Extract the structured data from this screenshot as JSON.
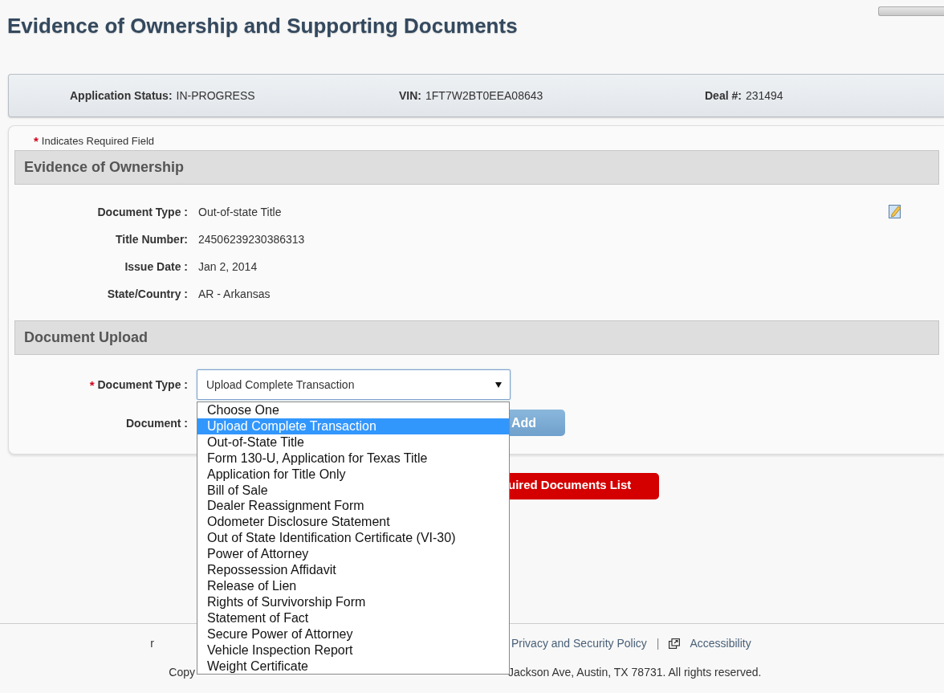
{
  "page": {
    "title": "Evidence of Ownership and Supporting Documents"
  },
  "status": [
    {
      "label": "Application Status:",
      "value": "IN-PROGRESS"
    },
    {
      "label": "VIN:",
      "value": "1FT7W2BT0EEA08643"
    },
    {
      "label": "Deal #:",
      "value": "231494"
    }
  ],
  "required_note": {
    "mark": "*",
    "text": "Indicates Required Field"
  },
  "ownership": {
    "heading": "Evidence of Ownership",
    "fields": [
      {
        "label": "Document Type :",
        "value": "Out-of-state Title"
      },
      {
        "label": "Title Number:",
        "value": "24506239230386313"
      },
      {
        "label": "Issue Date :",
        "value": "Jan 2, 2014"
      },
      {
        "label": "State/Country :",
        "value": "AR - Arkansas"
      }
    ]
  },
  "upload": {
    "heading": "Document Upload",
    "document_type": {
      "required_mark": "*",
      "label": "Document Type :",
      "value": "Upload Complete Transaction",
      "expanded": true,
      "options": [
        {
          "label": "Choose One",
          "selected": false
        },
        {
          "label": "Upload Complete Transaction",
          "selected": true
        },
        {
          "label": "Out-of-State Title",
          "selected": false
        },
        {
          "label": "Form 130-U, Application for Texas Title",
          "selected": false
        },
        {
          "label": "Application for Title Only",
          "selected": false
        },
        {
          "label": "Bill of Sale",
          "selected": false
        },
        {
          "label": "Dealer Reassignment Form",
          "selected": false
        },
        {
          "label": "Odometer Disclosure Statement",
          "selected": false
        },
        {
          "label": "Out of State Identification Certificate (VI-30)",
          "selected": false
        },
        {
          "label": "Power of Attorney",
          "selected": false
        },
        {
          "label": "Repossession Affidavit",
          "selected": false
        },
        {
          "label": "Release of Lien",
          "selected": false
        },
        {
          "label": "Rights of Survivorship Form",
          "selected": false
        },
        {
          "label": "Statement of Fact",
          "selected": false
        },
        {
          "label": "Secure Power of Attorney",
          "selected": false
        },
        {
          "label": "Vehicle Inspection Report",
          "selected": false
        },
        {
          "label": "Weight Certificate",
          "selected": false
        }
      ]
    },
    "document": {
      "label": "Document :"
    },
    "add_button": "Add",
    "list_button": "uired Documents List"
  },
  "footer": {
    "links": [
      "r",
      "Privacy and Security Policy",
      "Accessibility"
    ],
    "separator": "|",
    "copyright": [
      "Copy",
      "Jackson Ave, Austin, TX 78731. All rights reserved."
    ]
  }
}
